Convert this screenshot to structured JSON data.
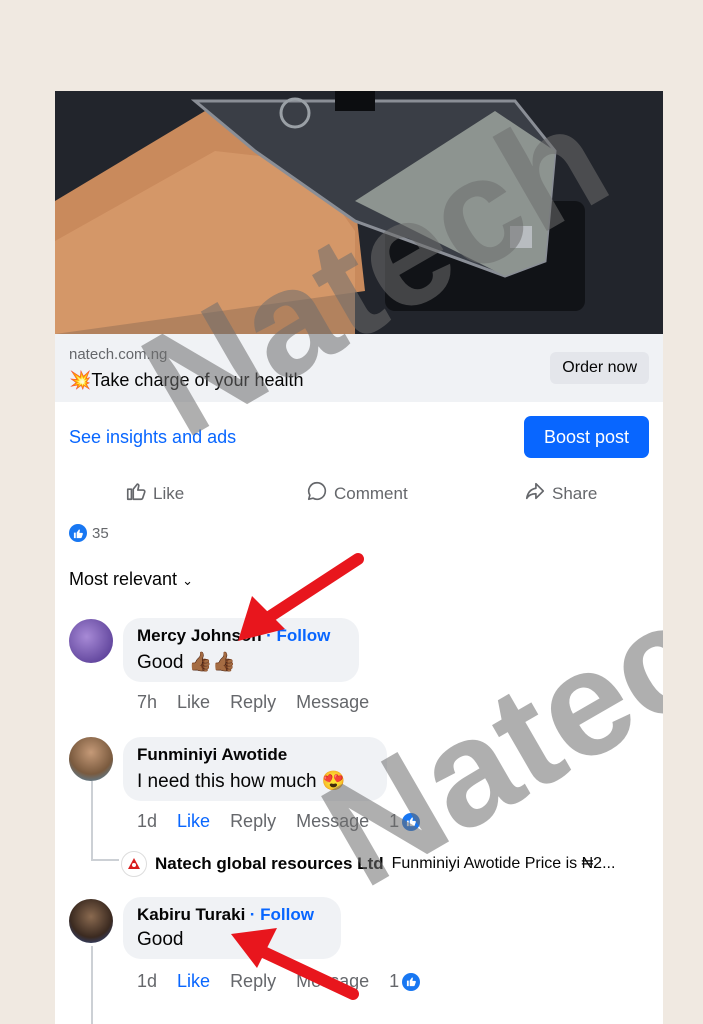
{
  "link_preview": {
    "domain": "natech.com.ng",
    "headline": "💥Take charge of your health",
    "cta_label": "Order now"
  },
  "post_bar": {
    "insights_label": "See insights and ads",
    "boost_label": "Boost post"
  },
  "actions": {
    "like": "Like",
    "comment": "Comment",
    "share": "Share"
  },
  "reactions": {
    "count": "35"
  },
  "sort_label": "Most relevant",
  "comments": [
    {
      "name": "Mercy Johnson",
      "follow": "· Follow",
      "text": "Good 👍🏾👍🏾",
      "time": "7h",
      "like": "Like",
      "reply": "Reply",
      "message": "Message"
    },
    {
      "name": "Funminiyi Awotide",
      "text": "I need this how much 😍",
      "time": "1d",
      "like": "Like",
      "reply": "Reply",
      "message": "Message",
      "reaction_count": "1",
      "reply_preview": {
        "author": "Natech global resources Ltd",
        "text": "Funminiyi Awotide Price is ₦2..."
      }
    },
    {
      "name": "Kabiru Turaki",
      "follow": "· Follow",
      "text": "Good",
      "time": "1d",
      "like": "Like",
      "reply": "Reply",
      "message": "Message",
      "reaction_count": "1"
    }
  ],
  "watermark": [
    "Natech",
    "Natech"
  ],
  "colors": {
    "brand_blue": "#0866ff",
    "arrow_red": "#e8161d",
    "page_bg": "#f0e9e1"
  }
}
